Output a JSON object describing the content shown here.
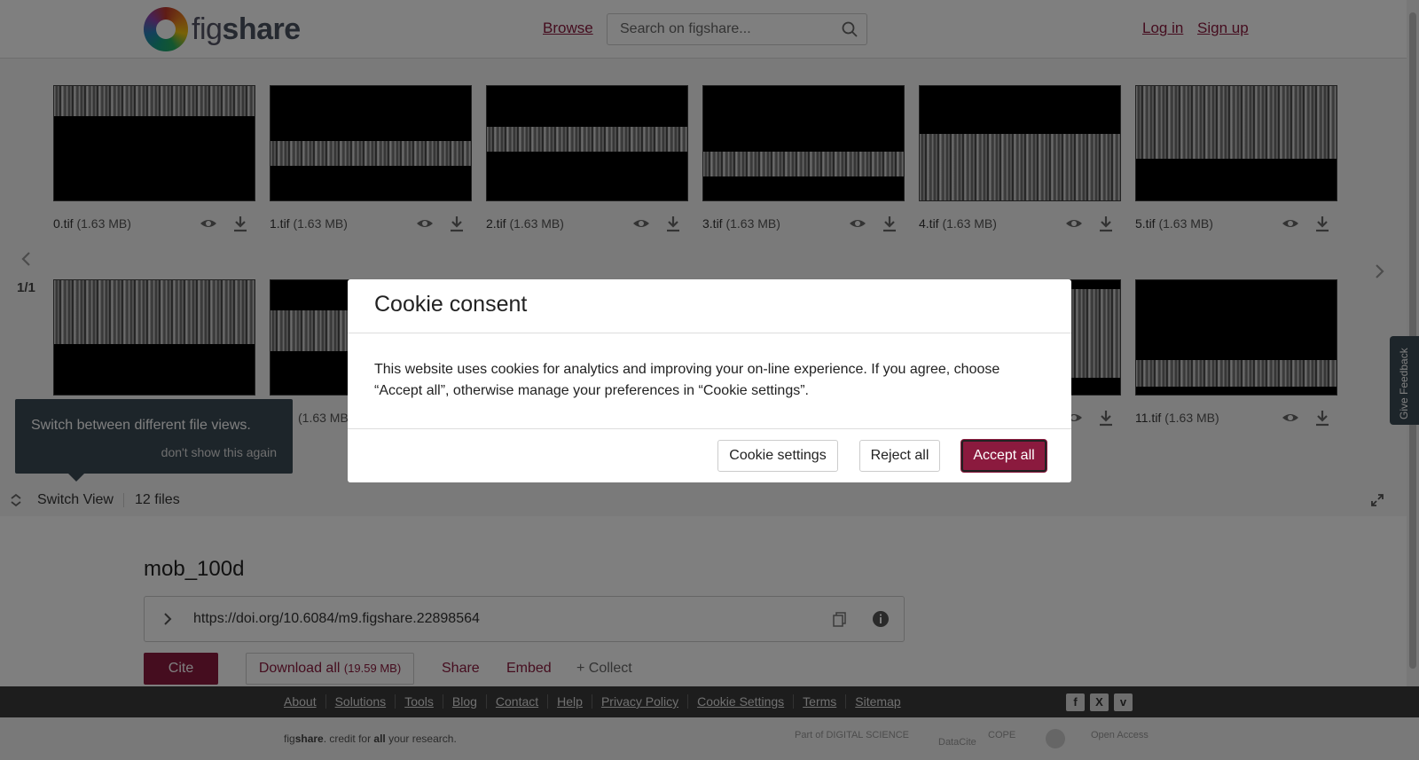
{
  "header": {
    "logo_text_light": "fig",
    "logo_text_bold": "share",
    "browse": "Browse",
    "search_placeholder": "Search on figshare...",
    "login": "Log in",
    "signup": "Sign up"
  },
  "viewer": {
    "files": [
      {
        "name": "0.tif",
        "size": "(1.63 MB)"
      },
      {
        "name": "1.tif",
        "size": "(1.63 MB)"
      },
      {
        "name": "2.tif",
        "size": "(1.63 MB)"
      },
      {
        "name": "3.tif",
        "size": "(1.63 MB)"
      },
      {
        "name": "4.tif",
        "size": "(1.63 MB)"
      },
      {
        "name": "5.tif",
        "size": "(1.63 MB)"
      },
      {
        "name": "",
        "size": ""
      },
      {
        "name": "",
        "size": "(1.63 MB)"
      },
      {
        "name": "",
        "size": ""
      },
      {
        "name": "",
        "size": ""
      },
      {
        "name": "",
        "size": ""
      },
      {
        "name": "11.tif",
        "size": "(1.63 MB)"
      }
    ],
    "pager": "1/1",
    "tooltip_message": "Switch between different file views.",
    "tooltip_dismiss": "don't show this again",
    "switch_view": "Switch View",
    "files_count": "12 files"
  },
  "item": {
    "title": "mob_100d",
    "doi": "https://doi.org/10.6084/m9.figshare.22898564",
    "cite": "Cite",
    "download_all": "Download all",
    "download_size": "(19.59 MB)",
    "share": "Share",
    "embed": "Embed",
    "collect": "+ Collect"
  },
  "footer": {
    "links": [
      "About",
      "Solutions",
      "Tools",
      "Blog",
      "Contact",
      "Help",
      "Privacy Policy",
      "Cookie Settings",
      "Terms",
      "Sitemap"
    ],
    "tagline_light": "fig",
    "tagline_bold": "share",
    "tagline_mid": ". credit for ",
    "tagline_all": "all",
    "tagline_end": " your research.",
    "social": [
      "f",
      "X",
      "v"
    ],
    "partners": [
      "Part of DIGITAL SCIENCE",
      "DataCite",
      "COPE",
      "",
      "Open Access"
    ]
  },
  "cookie_modal": {
    "title": "Cookie consent",
    "body": "This website uses cookies for analytics and improving your on-line experience. If you agree, choose “Accept all”, otherwise manage your preferences in “Cookie settings”.",
    "settings": "Cookie settings",
    "reject": "Reject all",
    "accept": "Accept all"
  },
  "feedback": "Give Feedback",
  "colors": {
    "brand": "#8b1a3e",
    "tooltip_bg": "#3a4a55",
    "footer_bg": "#3a3a3a"
  }
}
